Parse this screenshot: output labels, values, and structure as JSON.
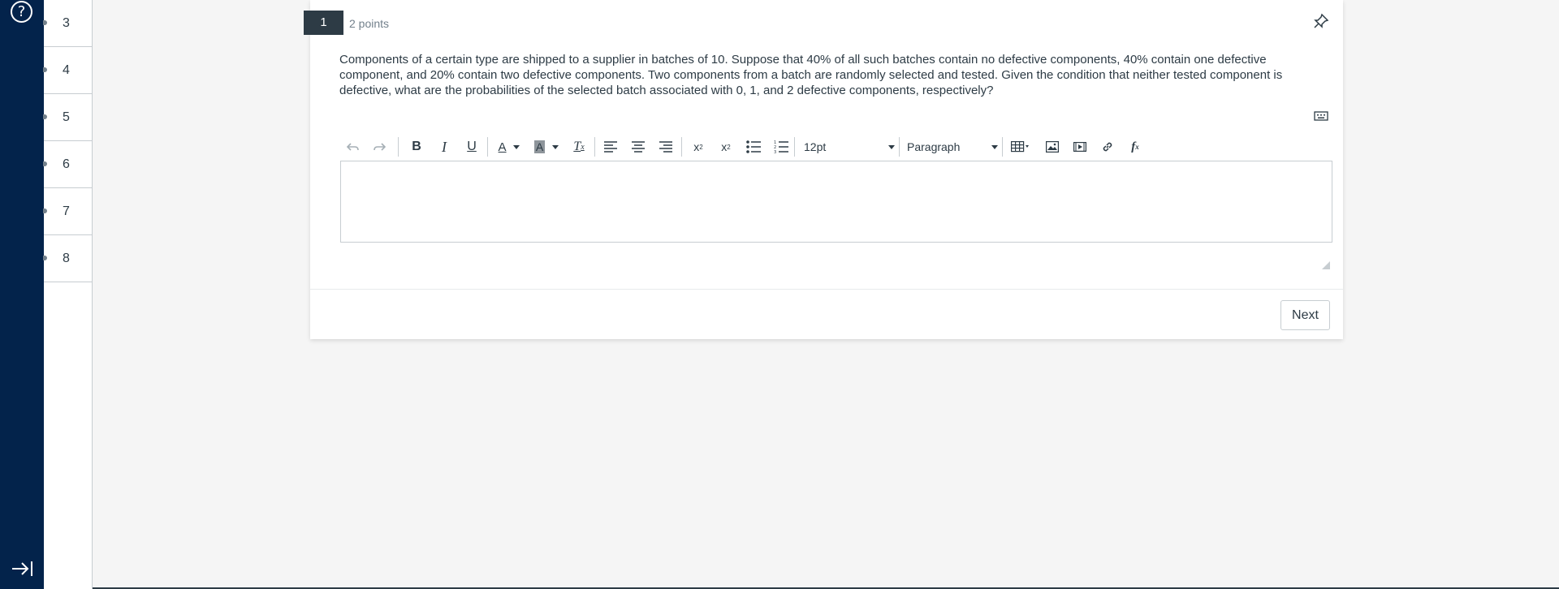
{
  "sidebar": {
    "help_glyph": "?",
    "question_numbers": [
      "3",
      "4",
      "5",
      "6",
      "7",
      "8"
    ]
  },
  "question": {
    "number": "1",
    "points": "2 points",
    "text": "Components of a certain type are shipped to a supplier in batches of 10. Suppose that 40% of all such batches contain no defective components, 40% contain one defective component, and 20% contain two defective components. Two components from a batch are randomly selected and tested. Given the condition that neither tested component is defective, what are the probabilities of the selected batch associated with 0, 1, and 2 defective components, respectively?"
  },
  "toolbar": {
    "font_size": "12pt",
    "block_format": "Paragraph",
    "icons": [
      "undo-icon",
      "redo-icon",
      "bold-icon",
      "italic-icon",
      "underline-icon",
      "text-color-icon",
      "highlight-color-icon",
      "clear-formatting-icon",
      "align-left-icon",
      "align-center-icon",
      "align-right-icon",
      "superscript-icon",
      "subscript-icon",
      "bullet-list-icon",
      "numbered-list-icon",
      "table-icon",
      "image-icon",
      "media-icon",
      "link-icon",
      "equation-icon"
    ]
  },
  "editor": {
    "value": ""
  },
  "footer": {
    "next_label": "Next"
  }
}
